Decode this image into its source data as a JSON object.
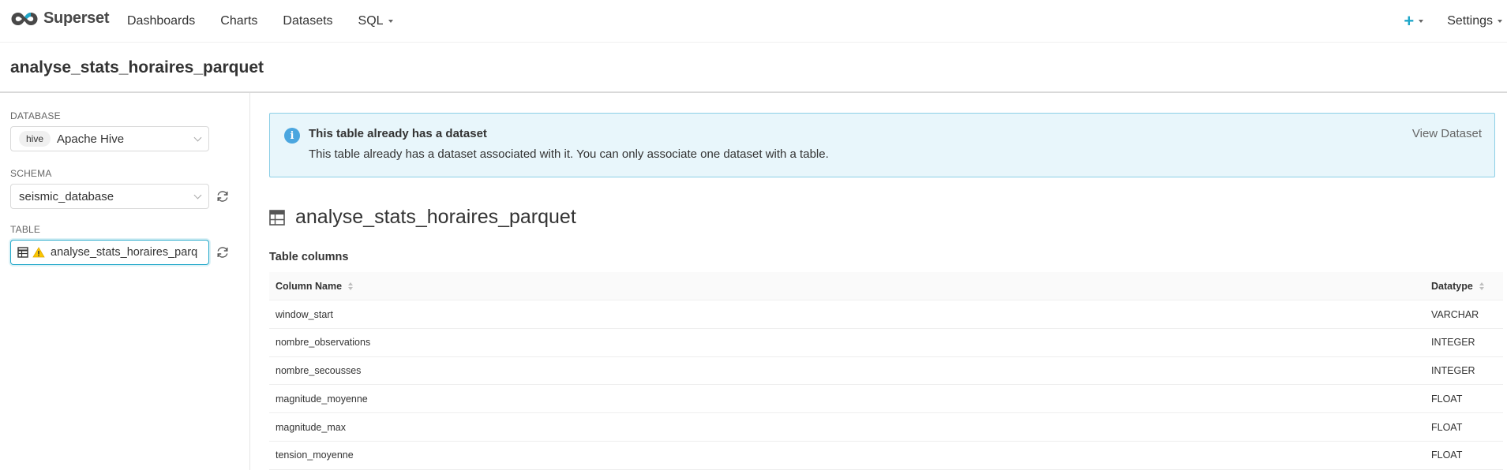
{
  "app": {
    "brand": "Superset",
    "nav": [
      {
        "label": "Dashboards"
      },
      {
        "label": "Charts"
      },
      {
        "label": "Datasets"
      },
      {
        "label": "SQL"
      }
    ],
    "plus_label": "+",
    "settings_label": "Settings",
    "accent_color": "#20a7c9"
  },
  "page": {
    "title": "analyse_stats_horaires_parquet"
  },
  "left_panel": {
    "database": {
      "label": "DATABASE",
      "tag": "hive",
      "value": "Apache Hive"
    },
    "schema": {
      "label": "SCHEMA",
      "value": "seismic_database"
    },
    "table": {
      "label": "TABLE",
      "value": "analyse_stats_horaires_parq"
    }
  },
  "alert": {
    "title": "This table already has a dataset",
    "description": "This table already has a dataset associated with it. You can only associate one dataset with a table.",
    "link": "View Dataset"
  },
  "dataset": {
    "title": "analyse_stats_horaires_parquet",
    "section_title": "Table columns",
    "columns_header": {
      "name": "Column Name",
      "type": "Datatype"
    },
    "rows": [
      {
        "name": "window_start",
        "type": "VARCHAR"
      },
      {
        "name": "nombre_observations",
        "type": "INTEGER"
      },
      {
        "name": "nombre_secousses",
        "type": "INTEGER"
      },
      {
        "name": "magnitude_moyenne",
        "type": "FLOAT"
      },
      {
        "name": "magnitude_max",
        "type": "FLOAT"
      },
      {
        "name": "tension_moyenne",
        "type": "FLOAT"
      }
    ]
  }
}
